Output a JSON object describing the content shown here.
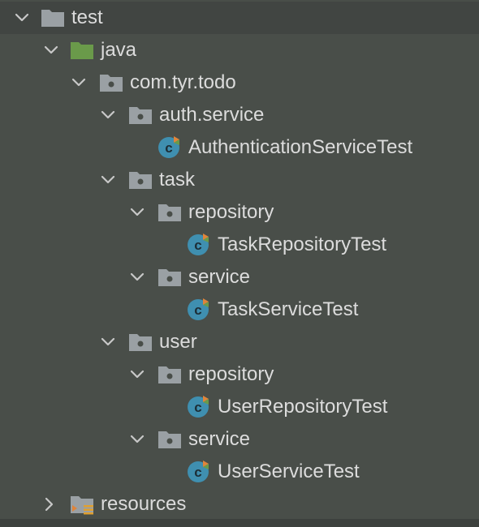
{
  "colors": {
    "background": "#494e49",
    "selected_row": "#414542",
    "text": "#dcdcdc",
    "chevron": "#c8c8c8",
    "folder_gray": "#9aa0a4",
    "folder_green": "#6a9a4a",
    "class_icon": "#3f8fb0",
    "class_icon_accent": "#e0843a"
  },
  "tree": {
    "rows": [
      {
        "label": "test",
        "icon": "folder-icon",
        "expanded": true
      },
      {
        "label": "java",
        "icon": "source-folder-icon",
        "expanded": true
      },
      {
        "label": "com.tyr.todo",
        "icon": "package-icon",
        "expanded": true
      },
      {
        "label": "auth.service",
        "icon": "package-icon",
        "expanded": true
      },
      {
        "label": "AuthenticationServiceTest",
        "icon": "test-class-icon"
      },
      {
        "label": "task",
        "icon": "package-icon",
        "expanded": true
      },
      {
        "label": "repository",
        "icon": "package-icon",
        "expanded": true
      },
      {
        "label": "TaskRepositoryTest",
        "icon": "test-class-icon"
      },
      {
        "label": "service",
        "icon": "package-icon",
        "expanded": true
      },
      {
        "label": "TaskServiceTest",
        "icon": "test-class-icon"
      },
      {
        "label": "user",
        "icon": "package-icon",
        "expanded": true
      },
      {
        "label": "repository",
        "icon": "package-icon",
        "expanded": true
      },
      {
        "label": "UserRepositoryTest",
        "icon": "test-class-icon"
      },
      {
        "label": "service",
        "icon": "package-icon",
        "expanded": true
      },
      {
        "label": "UserServiceTest",
        "icon": "test-class-icon"
      },
      {
        "label": "resources",
        "icon": "resources-folder-icon",
        "expanded": false
      }
    ]
  }
}
